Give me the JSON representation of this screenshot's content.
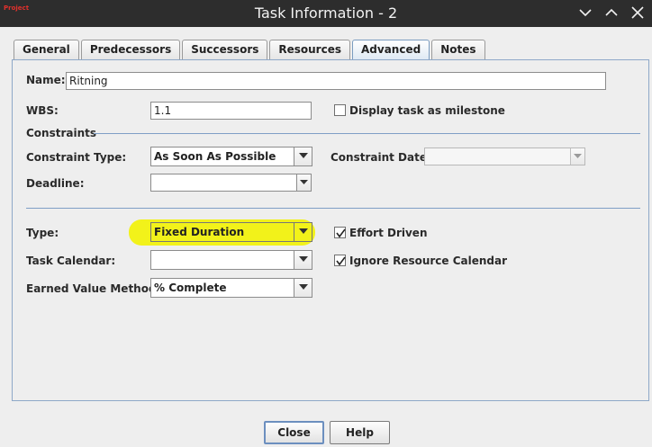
{
  "window": {
    "title": "Task Information - 2",
    "app_icon_text": "Project"
  },
  "tabs": [
    {
      "label": "General"
    },
    {
      "label": "Predecessors"
    },
    {
      "label": "Successors"
    },
    {
      "label": "Resources"
    },
    {
      "label": "Advanced",
      "active": true
    },
    {
      "label": "Notes"
    }
  ],
  "form": {
    "name": {
      "label": "Name:",
      "value": "Ritning"
    },
    "wbs": {
      "label": "WBS:",
      "value": "1.1"
    },
    "milestone": {
      "label": "Display task as milestone",
      "checked": false
    },
    "constraints_header": "Constraints",
    "constraint_type": {
      "label": "Constraint Type:",
      "value": "As Soon As Possible"
    },
    "constraint_date": {
      "label": "Constraint Date:",
      "value": ""
    },
    "deadline": {
      "label": "Deadline:",
      "value": ""
    },
    "type": {
      "label": "Type:",
      "value": "Fixed Duration"
    },
    "effort_driven": {
      "label": "Effort Driven",
      "checked": true
    },
    "task_calendar": {
      "label": "Task Calendar:",
      "value": ""
    },
    "ignore_resource_calendar": {
      "label": "Ignore Resource Calendar",
      "checked": true
    },
    "earned_value": {
      "label": "Earned Value Method:",
      "value": "% Complete"
    }
  },
  "buttons": {
    "close": "Close",
    "help": "Help"
  },
  "colors": {
    "titlebar": "#2d2d2d",
    "highlight": "#f2f21a",
    "panel_border": "#8ea8c8"
  }
}
